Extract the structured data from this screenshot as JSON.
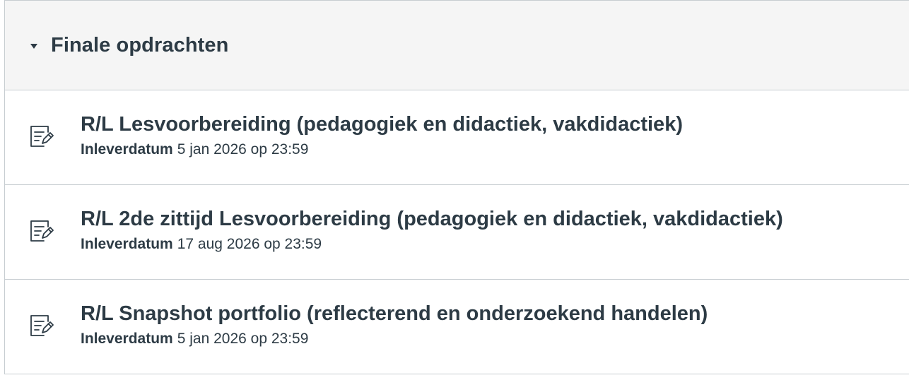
{
  "module": {
    "title": "Finale opdrachten",
    "items": [
      {
        "title": "R/L Lesvoorbereiding (pedagogiek en didactiek, vakdidactiek)",
        "due_label": "Inleverdatum",
        "due_date": "5 jan 2026 op 23:59",
        "icon": "assignment-icon"
      },
      {
        "title": "R/L 2de zittijd Lesvoorbereiding (pedagogiek en didactiek, vakdidactiek)",
        "due_label": "Inleverdatum",
        "due_date": "17 aug 2026 op 23:59",
        "icon": "assignment-icon"
      },
      {
        "title": "R/L Snapshot portfolio (reflecterend en onderzoekend handelen)",
        "due_label": "Inleverdatum",
        "due_date": "5 jan 2026 op 23:59",
        "icon": "assignment-icon"
      }
    ]
  },
  "colors": {
    "text": "#2d3b45",
    "header_bg": "#f5f5f5",
    "border": "#c7cdd1"
  }
}
